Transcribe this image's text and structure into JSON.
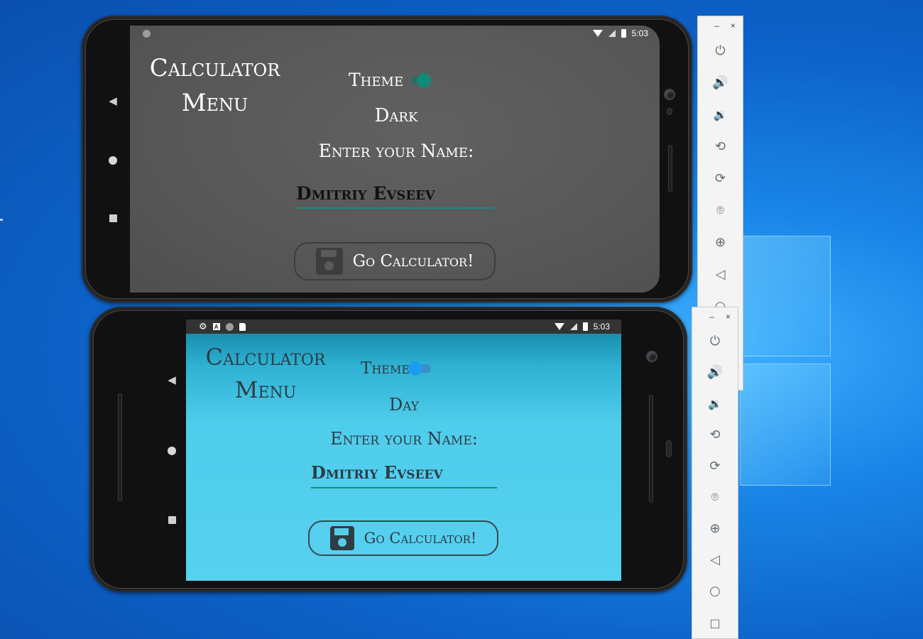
{
  "dark_phone": {
    "status": {
      "time": "5:03"
    },
    "title": [
      "Calculator",
      "Menu"
    ],
    "theme_label": "Theme",
    "mode_label": "Dark",
    "prompt": "Enter your Name:",
    "name_value": "Dmitriy Evseev",
    "button_label": "Go Calculator!",
    "colors": {
      "bg": "#5a5a5a",
      "text": "#ffffff",
      "accent": "#138a7a"
    }
  },
  "light_phone": {
    "status": {
      "time": "5:03"
    },
    "title": [
      "Calculator",
      "Menu"
    ],
    "theme_label": "Theme",
    "mode_label": "Day",
    "prompt": "Enter your Name:",
    "name_value": "Dmitriy Evseev",
    "button_label": "Go Calculator!",
    "colors": {
      "bg": "#55cdea",
      "text": "#2f3b45",
      "accent": "#1b9ef2"
    }
  },
  "emulator_toolbar": {
    "window_controls": [
      "–",
      "×"
    ],
    "tools": [
      "power-icon",
      "volume-up-icon",
      "volume-down-icon",
      "rotate-left-icon",
      "rotate-right-icon",
      "screenshot-icon",
      "zoom-icon",
      "back-icon",
      "home-icon",
      "overview-icon"
    ]
  }
}
